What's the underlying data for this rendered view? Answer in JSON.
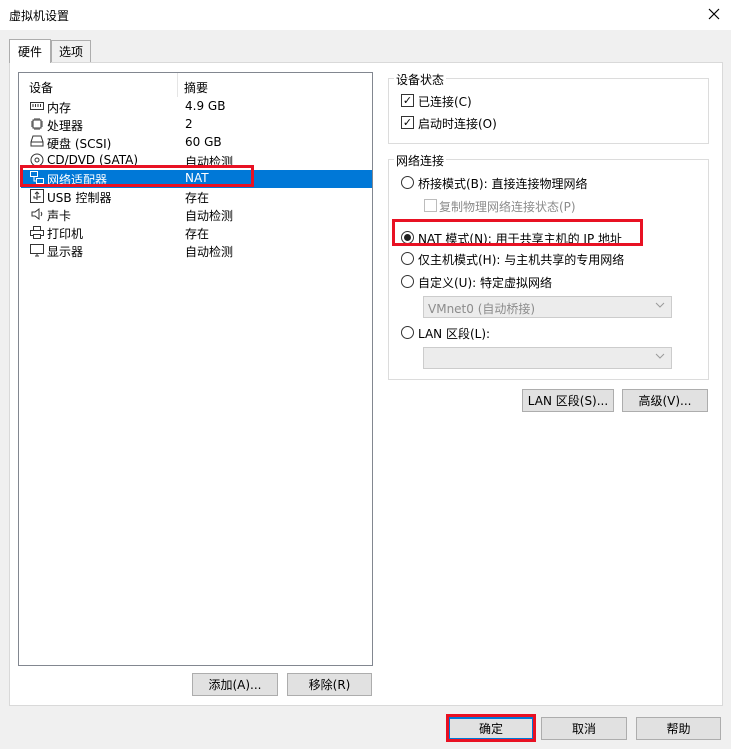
{
  "window": {
    "title": "虚拟机设置",
    "close_icon": "close-icon"
  },
  "tabs": [
    {
      "label": "硬件",
      "active": true
    },
    {
      "label": "选项",
      "active": false
    }
  ],
  "device_list": {
    "headers": {
      "device": "设备",
      "summary": "摘要"
    },
    "rows": [
      {
        "name": "内存",
        "summary": "4.9 GB",
        "icon": "memory-icon"
      },
      {
        "name": "处理器",
        "summary": "2",
        "icon": "processor-icon"
      },
      {
        "name": "硬盘 (SCSI)",
        "summary": "60 GB",
        "icon": "hard-disk-icon"
      },
      {
        "name": "CD/DVD (SATA)",
        "summary": "自动检测",
        "icon": "cd-dvd-icon"
      },
      {
        "name": "网络适配器",
        "summary": "NAT",
        "icon": "network-adapter-icon",
        "selected": true
      },
      {
        "name": "USB 控制器",
        "summary": "存在",
        "icon": "usb-icon"
      },
      {
        "name": "声卡",
        "summary": "自动检测",
        "icon": "sound-card-icon"
      },
      {
        "name": "打印机",
        "summary": "存在",
        "icon": "printer-icon"
      },
      {
        "name": "显示器",
        "summary": "自动检测",
        "icon": "display-icon"
      }
    ],
    "add_button": "添加(A)...",
    "remove_button": "移除(R)"
  },
  "device_status": {
    "title": "设备状态",
    "connected": {
      "label": "已连接(C)",
      "checked": true
    },
    "connect_at_power_on": {
      "label": "启动时连接(O)",
      "checked": true
    }
  },
  "network_connection": {
    "title": "网络连接",
    "bridged": {
      "label": "桥接模式(B): 直接连接物理网络",
      "selected": false
    },
    "replicate_state": {
      "label": "复制物理网络连接状态(P)",
      "checked": false,
      "enabled": false
    },
    "nat": {
      "label": "NAT 模式(N): 用于共享主机的 IP 地址",
      "selected": true
    },
    "host_only": {
      "label": "仅主机模式(H): 与主机共享的专用网络",
      "selected": false
    },
    "custom": {
      "label": "自定义(U): 特定虚拟网络",
      "selected": false
    },
    "custom_select": "VMnet0 (自动桥接)",
    "lan_segment": {
      "label": "LAN 区段(L):",
      "selected": false
    },
    "lan_select": ""
  },
  "lan_segments_button": "LAN 区段(S)...",
  "advanced_button": "高级(V)...",
  "footer": {
    "ok": "确定",
    "cancel": "取消",
    "help": "帮助"
  },
  "colors": {
    "selection": "#0078d7",
    "highlight_box": "#e81123"
  }
}
